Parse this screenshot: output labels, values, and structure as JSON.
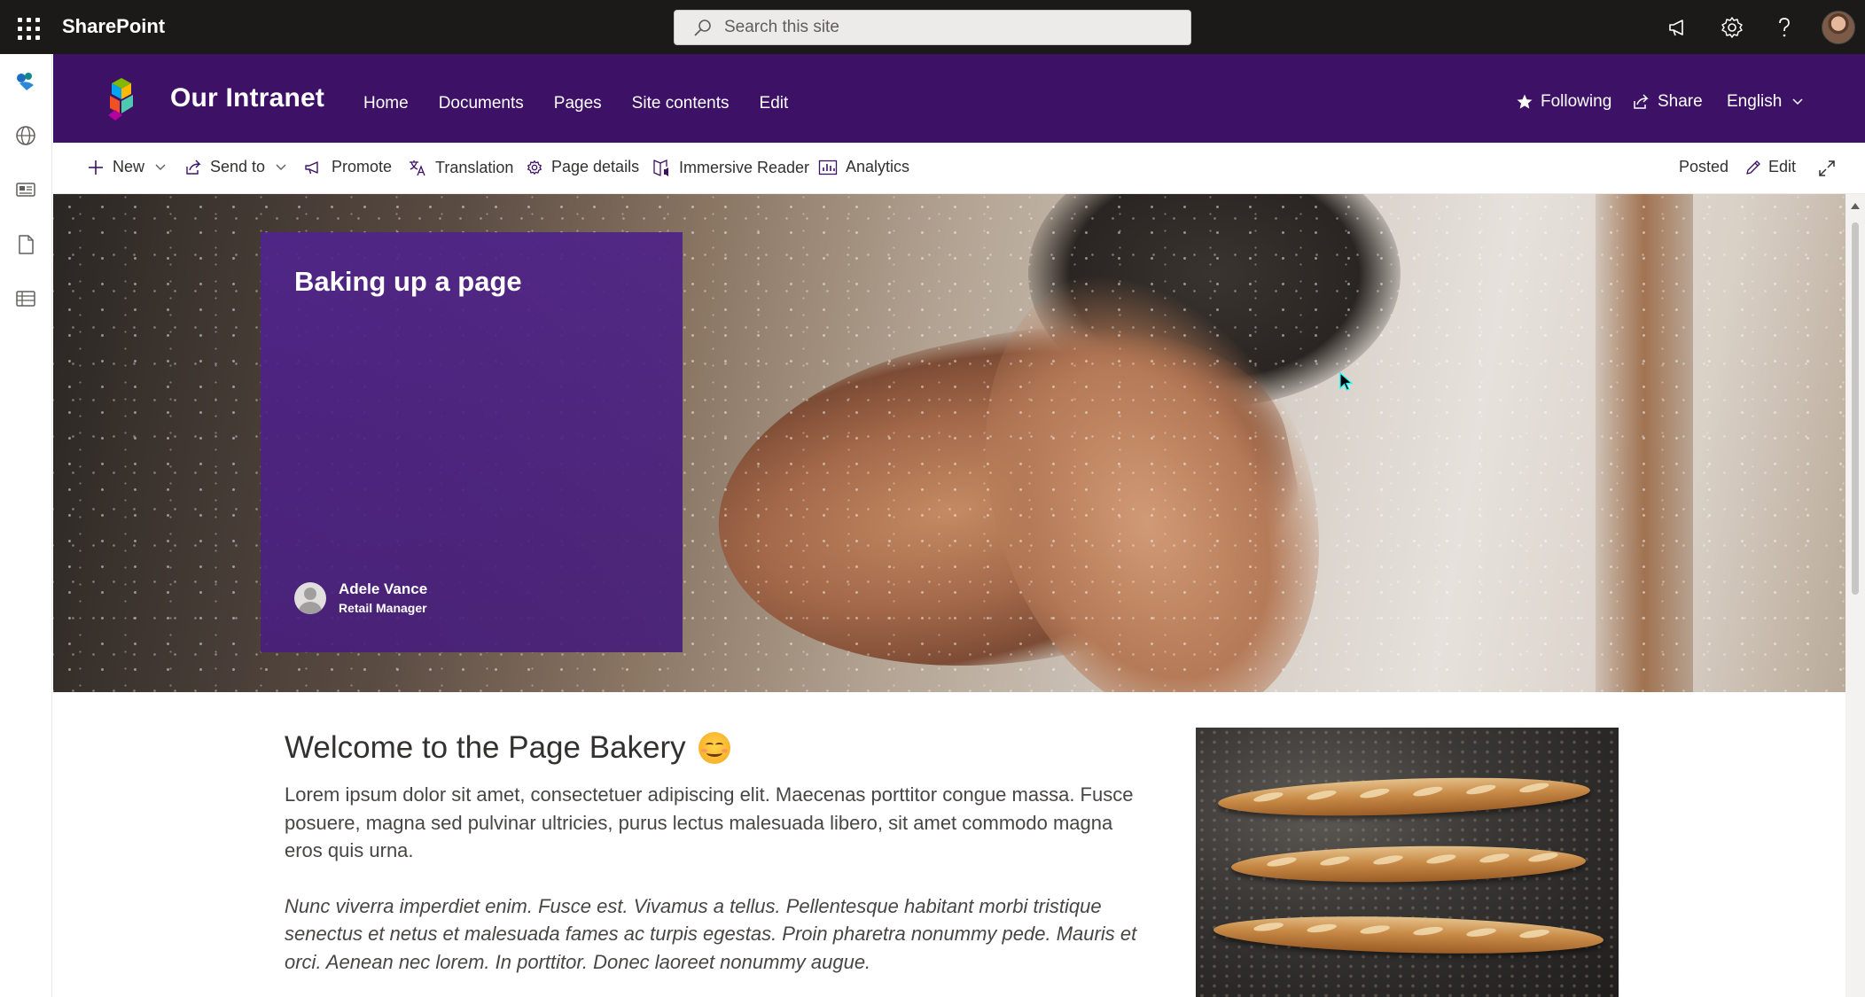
{
  "suite_bar": {
    "brand": "SharePoint",
    "search_placeholder": "Search this site"
  },
  "site_header": {
    "title": "Our Intranet",
    "nav": [
      "Home",
      "Documents",
      "Pages",
      "Site contents",
      "Edit"
    ],
    "following": "Following",
    "share": "Share",
    "language": "English"
  },
  "command_bar": {
    "new": "New",
    "send_to": "Send to",
    "promote": "Promote",
    "translation": "Translation",
    "page_details": "Page details",
    "immersive_reader": "Immersive Reader",
    "analytics": "Analytics",
    "posted": "Posted",
    "edit": "Edit"
  },
  "hero": {
    "title": "Baking up a page",
    "author_name": "Adele Vance",
    "author_role": "Retail Manager"
  },
  "article": {
    "heading": "Welcome to the Page Bakery",
    "paragraph1": "Lorem ipsum dolor sit amet, consectetuer adipiscing elit. Maecenas porttitor congue massa. Fusce posuere, magna sed pulvinar ultricies, purus lectus malesuada libero, sit amet commodo magna eros quis urna.",
    "paragraph2": "Nunc viverra imperdiet enim. Fusce est. Vivamus a tellus. Pellentesque habitant morbi tristique senectus et netus et malesuada fames ac turpis egestas. Proin pharetra nonummy pede. Mauris et orci. Aenean nec lorem. In porttitor. Donec laoreet nonummy augue."
  },
  "colors": {
    "suite_bar": "#1b1a19",
    "site_header": "#3d1165",
    "title_card": "#50248c"
  }
}
